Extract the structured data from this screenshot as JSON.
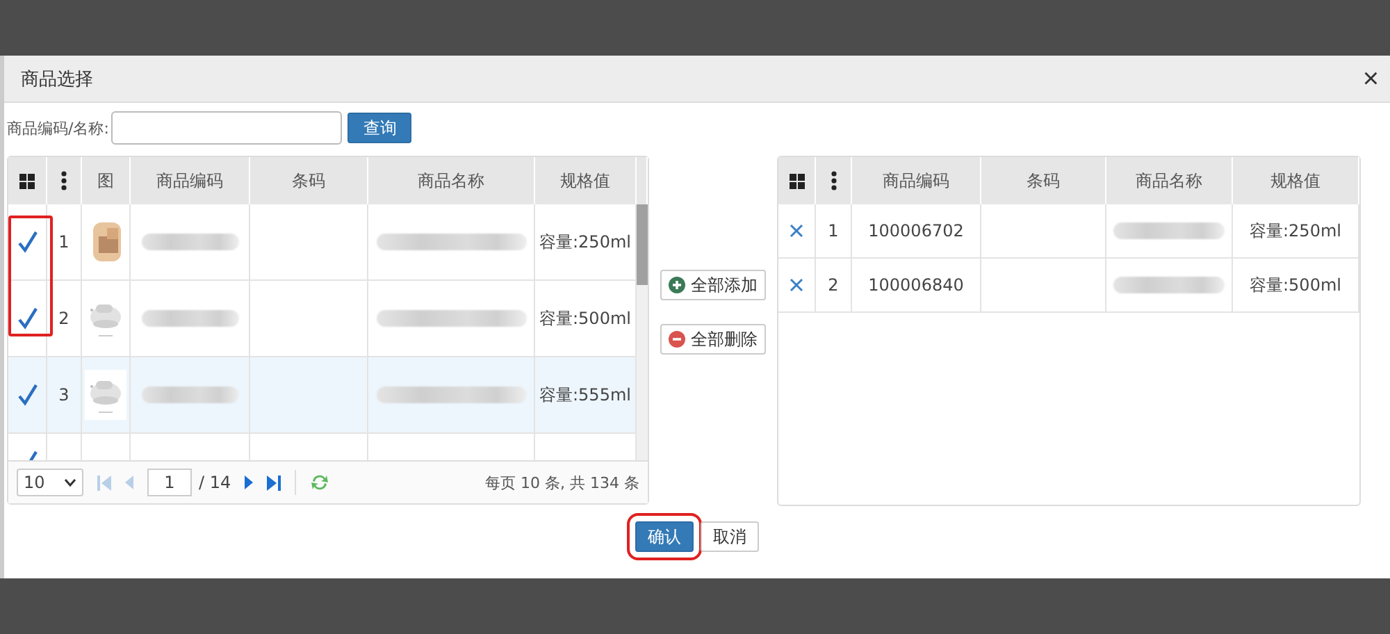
{
  "dialog": {
    "title": "商品选择",
    "close": "×"
  },
  "search": {
    "label": "商品编码/名称:",
    "button": "查询"
  },
  "left_table": {
    "columns": [
      "图",
      "商品编码",
      "条码",
      "商品名称",
      "规格值"
    ],
    "rows": [
      {
        "checked": true,
        "no": "1",
        "spec": "容量:250ml",
        "selected": false
      },
      {
        "checked": true,
        "no": "2",
        "spec": "容量:500ml",
        "selected": false
      },
      {
        "checked": true,
        "no": "3",
        "spec": "容量:555ml",
        "selected": true
      },
      {
        "checked": true,
        "selected": false
      }
    ],
    "pager": {
      "page_size": "10",
      "page": "1",
      "total_pages": "/ 14",
      "summary": "每页 10 条, 共 134 条"
    }
  },
  "transfer_buttons": [
    {
      "kind": "add",
      "label": "全部添加"
    },
    {
      "kind": "remove",
      "label": "全部删除"
    }
  ],
  "right_table": {
    "columns": [
      "商品编码",
      "条码",
      "商品名称",
      "规格值"
    ],
    "rows": [
      {
        "no": "1",
        "code": "100006702",
        "spec": "容量:250ml"
      },
      {
        "no": "2",
        "code": "100006840",
        "spec": "容量:500ml"
      }
    ]
  },
  "footer": {
    "buttons": [
      {
        "kind": "primary",
        "label": "确认",
        "highlighted": true
      },
      {
        "kind": "default",
        "label": "取消",
        "highlighted": false
      }
    ]
  },
  "highlight_checks": true
}
